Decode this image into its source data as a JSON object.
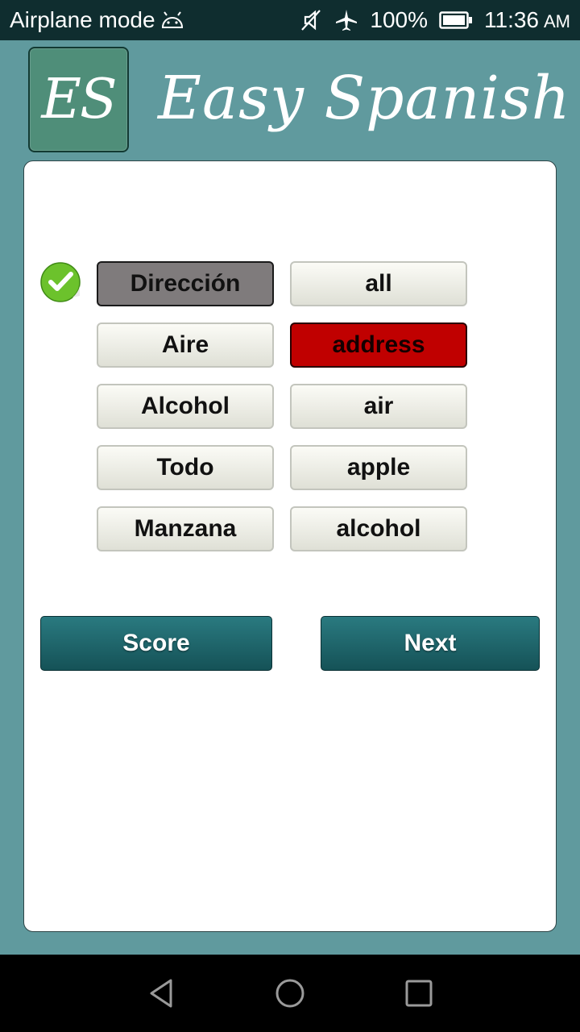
{
  "status_bar": {
    "mode_label": "Airplane mode",
    "battery": "100%",
    "time": "11:36",
    "ampm": "AM",
    "icons": [
      "android-icon",
      "mute-icon",
      "airplane-icon",
      "battery-icon"
    ]
  },
  "header": {
    "logo_text": "ES",
    "title": "Easy Spanish"
  },
  "quiz": {
    "spanish_words": [
      "Dirección",
      "Aire",
      "Alcohol",
      "Todo",
      "Manzana"
    ],
    "english_words": [
      "all",
      "address",
      "air",
      "apple",
      "alcohol"
    ],
    "selected_spanish": "Dirección",
    "wrong_english": "address",
    "status_icon": "check-icon"
  },
  "actions": {
    "score_label": "Score",
    "next_label": "Next"
  },
  "colors": {
    "background": "#609a9e",
    "status_bar": "#0f2d2f",
    "selected_button": "#7f7b7c",
    "wrong_button": "#c00000",
    "action_button": "#1d636a",
    "check_green": "#6cc22c"
  },
  "nav": {
    "icons": [
      "back-icon",
      "home-icon",
      "recent-apps-icon"
    ]
  }
}
